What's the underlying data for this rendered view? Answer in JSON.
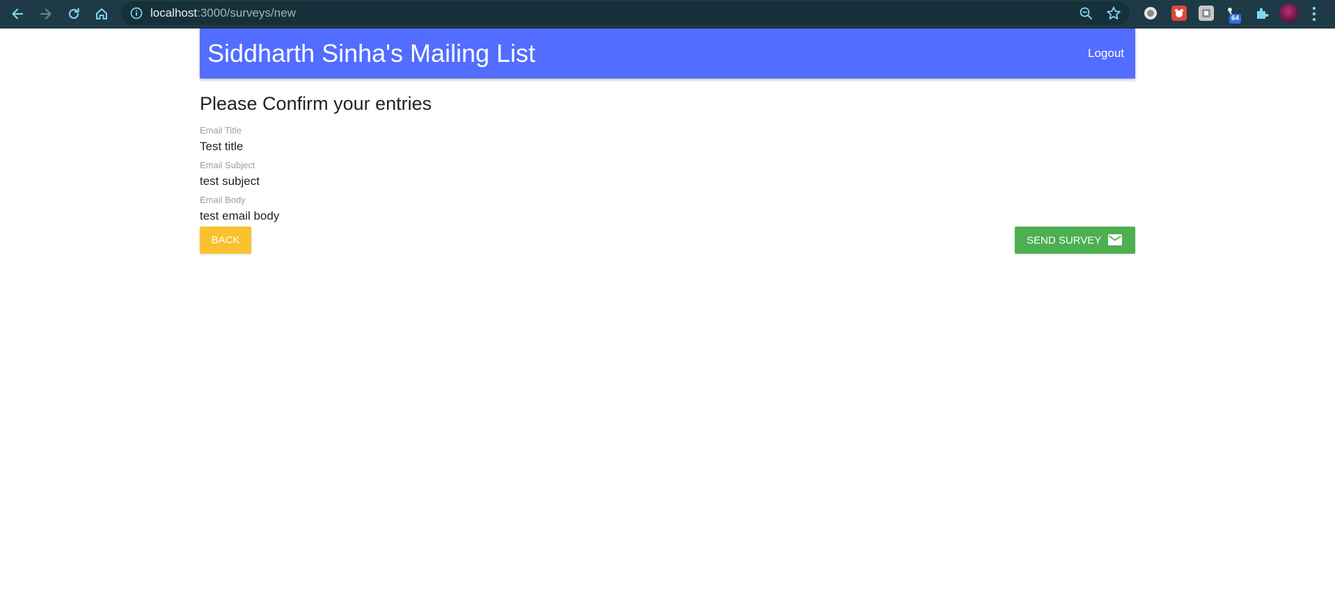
{
  "browser": {
    "url_host": "localhost",
    "url_path": ":3000/surveys/new",
    "extension_badge": "64",
    "nav_icons": [
      "back-icon",
      "forward-icon",
      "reload-icon",
      "home-icon"
    ],
    "omnibox_icons": [
      "info-icon",
      "zoom-icon",
      "star-icon"
    ],
    "extension_icons": [
      "record-extension-icon",
      "red-extension-icon",
      "grey-extension-icon",
      "badge-extension-icon",
      "puzzle-extensions-icon"
    ],
    "colors": {
      "toolbar": "#1e3a47",
      "icon": "#7fd6f2"
    }
  },
  "app": {
    "brand": "Siddharth Sinha's Mailing List",
    "logout_label": "Logout",
    "colors": {
      "app_bar": "#526dff",
      "back_button": "#fbc02d",
      "send_button": "#4caf50"
    }
  },
  "review": {
    "heading": "Please Confirm your entries",
    "fields": [
      {
        "label": "Email Title",
        "value": "Test title"
      },
      {
        "label": "Email Subject",
        "value": "test subject"
      },
      {
        "label": "Email Body",
        "value": "test email body"
      }
    ],
    "back_label": "Back",
    "send_label": "Send Survey",
    "send_icon": "email-icon"
  }
}
